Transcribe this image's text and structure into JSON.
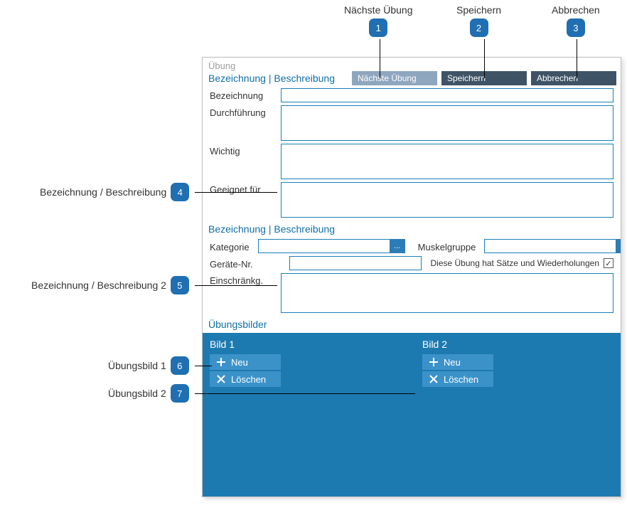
{
  "callouts": {
    "t1": "Nächste Übung",
    "t2": "Speichern",
    "t3": "Abbrechen",
    "l4": "Bezeichnung / Beschreibung",
    "l5": "Bezeichnung / Beschreibung 2",
    "l6": "Übungsbild 1",
    "l7": "Übungsbild 2",
    "n1": "1",
    "n2": "2",
    "n3": "3",
    "n4": "4",
    "n5": "5",
    "n6": "6",
    "n7": "7"
  },
  "panel": {
    "title": "Übung",
    "section1": "Bezeichnung | Beschreibung",
    "buttons": {
      "next": "Nächste Übung",
      "save": "Speichern",
      "cancel": "Abbrechen"
    },
    "labels": {
      "bezeichnung": "Bezeichnung",
      "durchfuehrung": "Durchführung",
      "wichtig": "Wichtig",
      "geeignet": "Geeignet für"
    },
    "section2": "Bezeichnung | Beschreibung",
    "labels2": {
      "kategorie": "Kategorie",
      "muskelgruppe": "Muskelgruppe",
      "geraet": "Geräte-Nr.",
      "satz": "Diese Übung hat Sätze und Wiederholungen",
      "einschr": "Einschränkg."
    },
    "picker_btn": "...",
    "section3": "Übungsbilder",
    "images": {
      "bild1": "Bild 1",
      "bild2": "Bild 2",
      "neu": "Neu",
      "loeschen": "Löschen"
    },
    "chk_mark": "✓"
  }
}
